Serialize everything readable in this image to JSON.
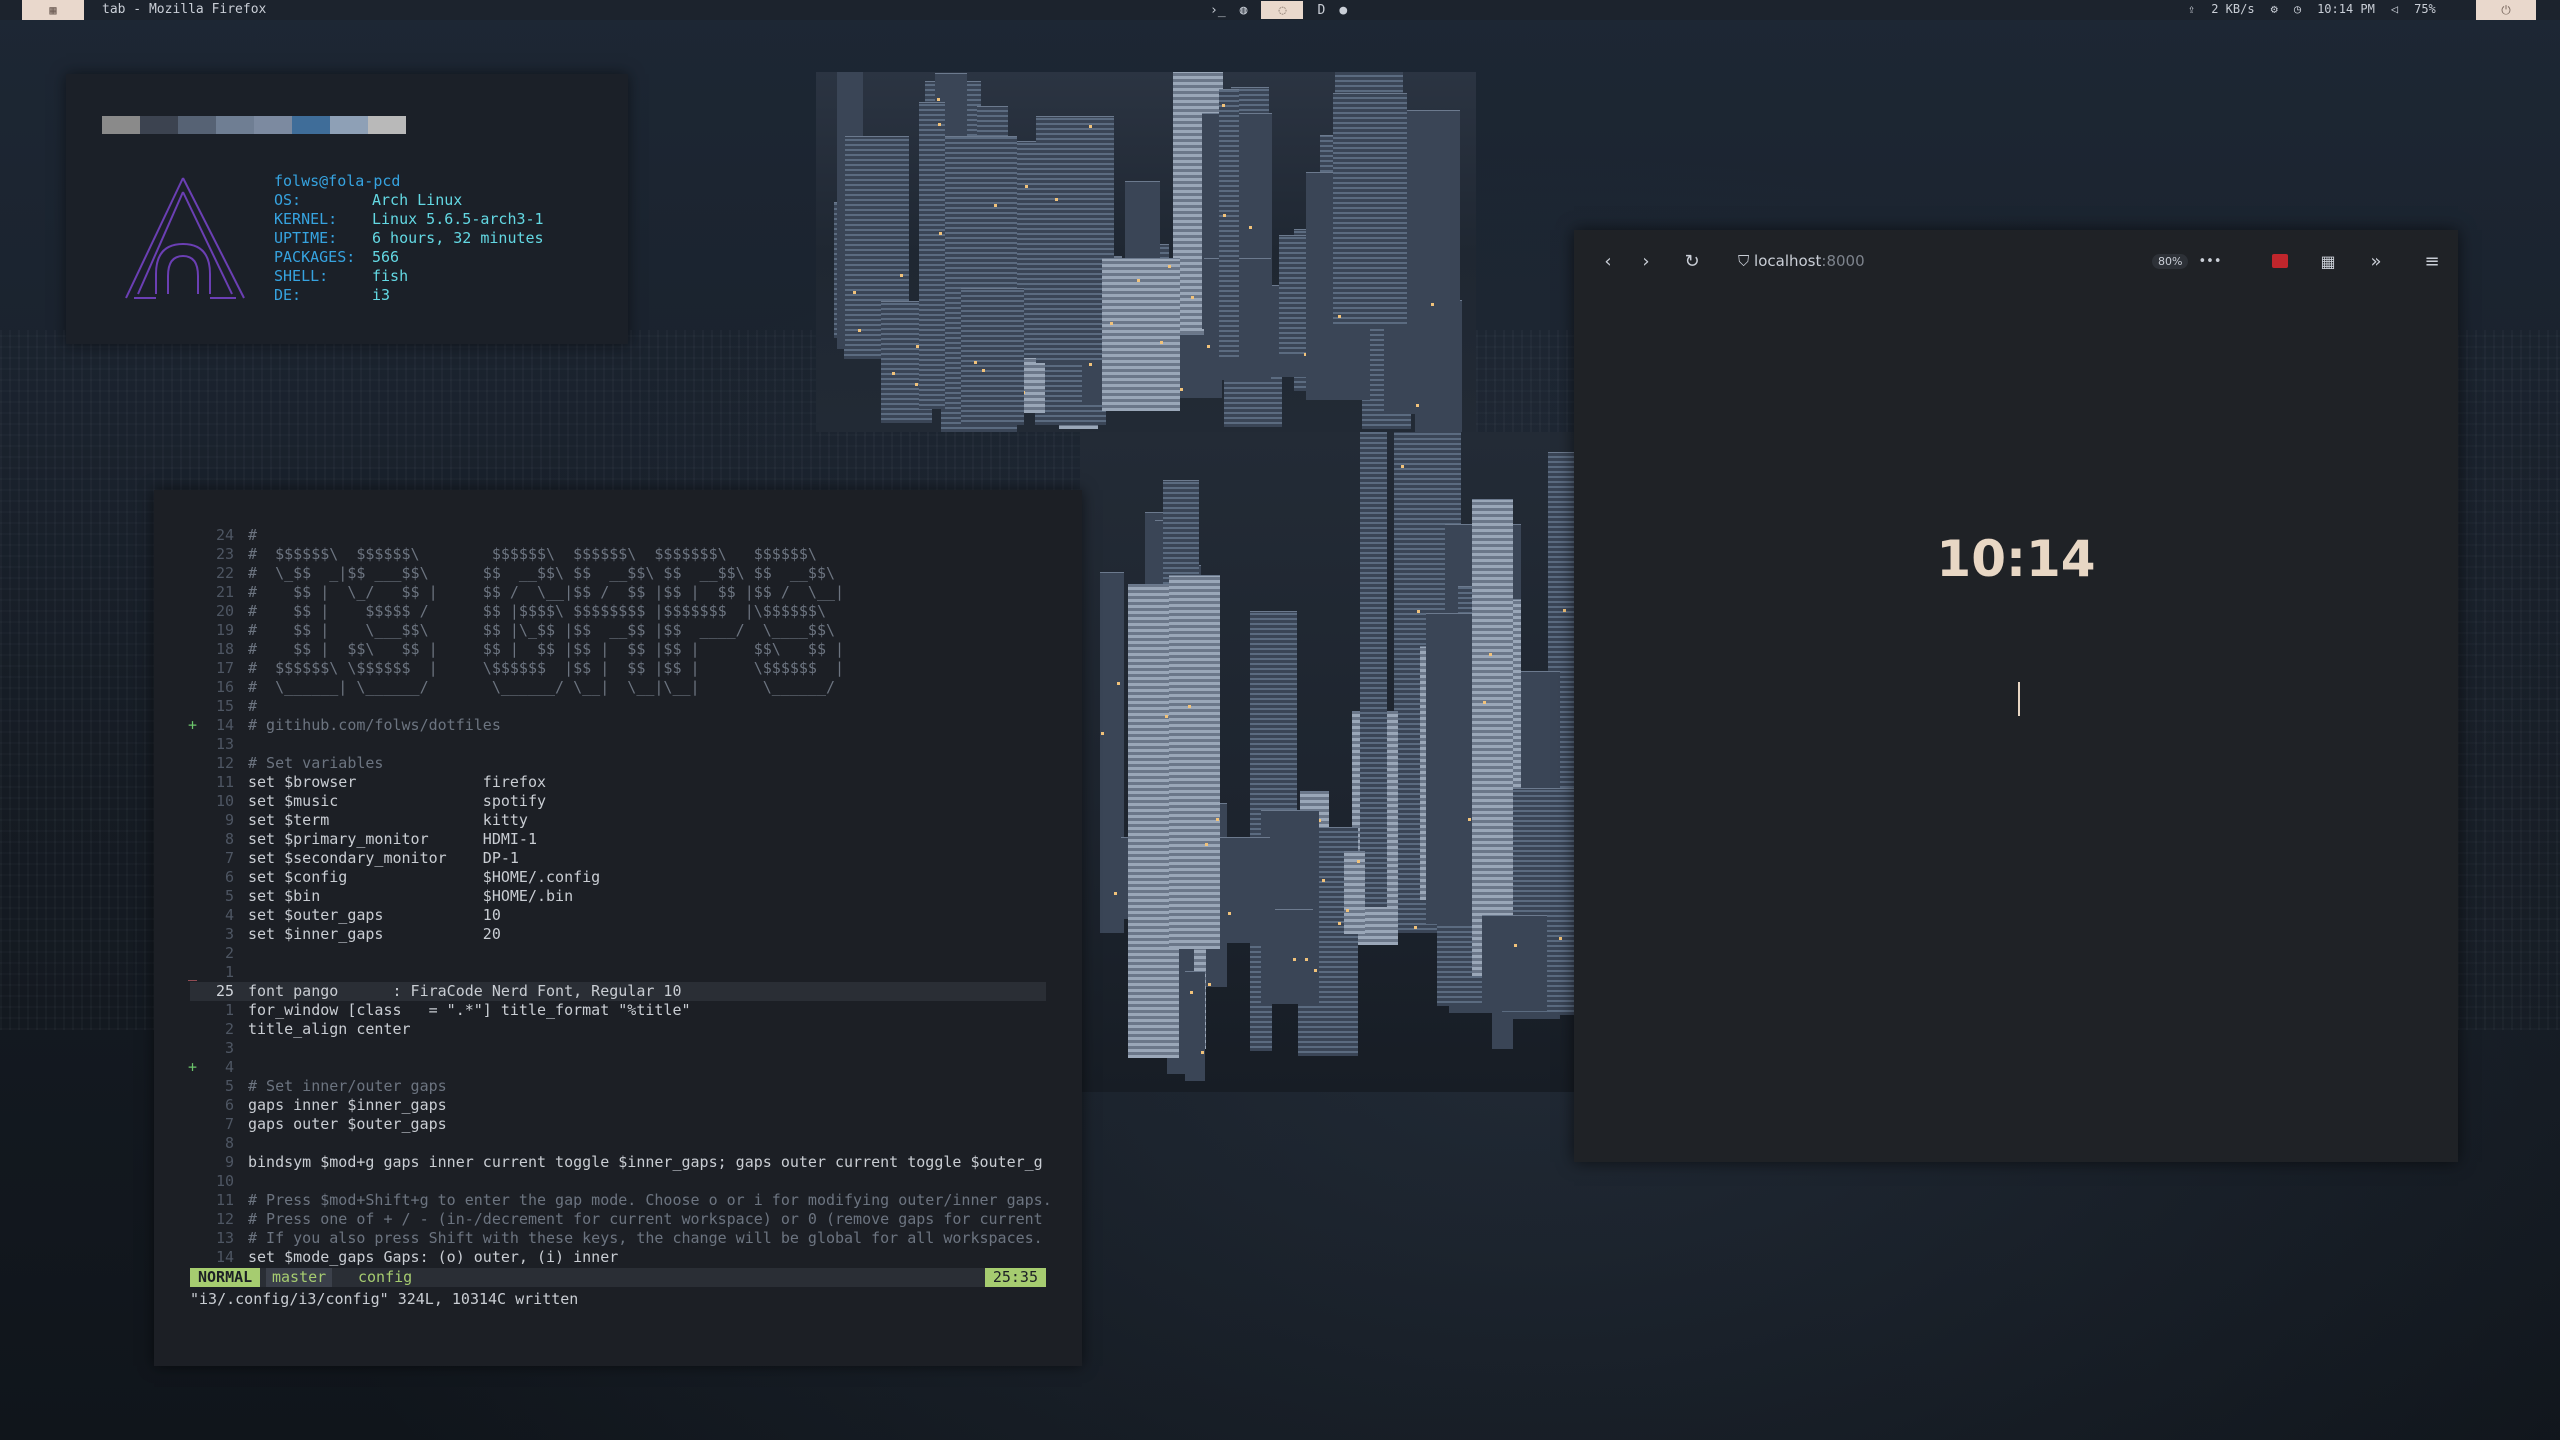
{
  "topbar": {
    "workspace_icon": "grid-icon",
    "window_title": "tab - Mozilla Firefox",
    "center": {
      "terminal_glyph": "›_",
      "globe_glyph": "◍",
      "active_glyph": "◌",
      "letter": "D",
      "spotify_glyph": "●"
    },
    "upload_glyph": "⇪",
    "net_speed": "2 KB/s",
    "clock": "10:14 PM",
    "volume": "75%",
    "power_glyph": "⏻"
  },
  "neofetch": {
    "user": "folws@fola-pcd",
    "rows": [
      {
        "key": "OS:",
        "value": "Arch Linux"
      },
      {
        "key": "KERNEL:",
        "value": "Linux 5.6.5-arch3-1"
      },
      {
        "key": "UPTIME:",
        "value": "6 hours, 32 minutes"
      },
      {
        "key": "PACKAGES:",
        "value": "566"
      },
      {
        "key": "SHELL:",
        "value": "fish"
      },
      {
        "key": "DE:",
        "value": "i3"
      }
    ],
    "swatch_colors": [
      "#8a8a8a",
      "#3c4350",
      "#566274",
      "#6f7e93",
      "#7c8aa0",
      "#3f6d99",
      "#8ea0b6",
      "#b9b9b9"
    ],
    "logo_color": "#6b3fb4"
  },
  "vim": {
    "lines": [
      {
        "n": "24",
        "t": "#",
        "cls": "comment"
      },
      {
        "n": "23",
        "t": "#  $$$$$$\\  $$$$$$\\        $$$$$$\\  $$$$$$\\  $$$$$$$\\   $$$$$$\\",
        "cls": "comment"
      },
      {
        "n": "22",
        "t": "#  \\_$$  _|$$ ___$$\\      $$  __$$\\ $$  __$$\\ $$  __$$\\ $$  __$$\\",
        "cls": "comment"
      },
      {
        "n": "21",
        "t": "#    $$ |  \\_/   $$ |     $$ /  \\__|$$ /  $$ |$$ |  $$ |$$ /  \\__|",
        "cls": "comment"
      },
      {
        "n": "20",
        "t": "#    $$ |    $$$$$ /      $$ |$$$$\\ $$$$$$$$ |$$$$$$$  |\\$$$$$$\\",
        "cls": "comment"
      },
      {
        "n": "19",
        "t": "#    $$ |    \\___$$\\      $$ |\\_$$ |$$  __$$ |$$  ____/  \\____$$\\",
        "cls": "comment"
      },
      {
        "n": "18",
        "t": "#    $$ |  $$\\   $$ |     $$ |  $$ |$$ |  $$ |$$ |      $$\\   $$ |",
        "cls": "comment"
      },
      {
        "n": "17",
        "t": "#  $$$$$$\\ \\$$$$$$  |     \\$$$$$$  |$$ |  $$ |$$ |      \\$$$$$$  |",
        "cls": "comment"
      },
      {
        "n": "16",
        "t": "#  \\______| \\______/       \\______/ \\__|  \\__|\\__|       \\______/",
        "cls": "comment"
      },
      {
        "n": "15",
        "t": "#",
        "cls": "comment"
      },
      {
        "n": "14",
        "t": "# gitihub.com/folws/dotfiles",
        "cls": "comment",
        "sign": "+"
      },
      {
        "n": "13",
        "t": "",
        "cls": "txt"
      },
      {
        "n": "12",
        "t": "# Set variables",
        "cls": "comment"
      },
      {
        "n": "11",
        "t": "set $browser              firefox",
        "cls": "txt"
      },
      {
        "n": "10",
        "t": "set $music                spotify",
        "cls": "txt"
      },
      {
        "n": "9",
        "t": "set $term                 kitty",
        "cls": "txt"
      },
      {
        "n": "8",
        "t": "set $primary_monitor      HDMI-1",
        "cls": "txt"
      },
      {
        "n": "7",
        "t": "set $secondary_monitor    DP-1",
        "cls": "txt"
      },
      {
        "n": "6",
        "t": "set $config               $HOME/.config",
        "cls": "txt"
      },
      {
        "n": "5",
        "t": "set $bin                  $HOME/.bin",
        "cls": "txt"
      },
      {
        "n": "4",
        "t": "set $outer_gaps           10",
        "cls": "txt"
      },
      {
        "n": "3",
        "t": "set $inner_gaps           20",
        "cls": "txt"
      },
      {
        "n": "2",
        "t": "",
        "cls": "txt"
      },
      {
        "n": "1",
        "t": "",
        "cls": "txt",
        "sign": "_"
      },
      {
        "n": "25",
        "t": "font pango      : FiraCode Nerd Font, Regular 10",
        "cls": "txt",
        "current": true
      },
      {
        "n": "1",
        "t": "for_window [class   = \".*\"] title_format \"%title\"",
        "cls": "txt"
      },
      {
        "n": "2",
        "t": "title_align center",
        "cls": "txt"
      },
      {
        "n": "3",
        "t": "",
        "cls": "txt"
      },
      {
        "n": "4",
        "t": "",
        "cls": "txt",
        "sign": "+"
      },
      {
        "n": "5",
        "t": "# Set inner/outer gaps",
        "cls": "comment"
      },
      {
        "n": "6",
        "t": "gaps inner $inner_gaps",
        "cls": "txt"
      },
      {
        "n": "7",
        "t": "gaps outer $outer_gaps",
        "cls": "txt"
      },
      {
        "n": "8",
        "t": "",
        "cls": "txt"
      },
      {
        "n": "9",
        "t": "bindsym $mod+g gaps inner current toggle $inner_gaps; gaps outer current toggle $outer_g",
        "cls": "txt"
      },
      {
        "n": "10",
        "t": "",
        "cls": "txt"
      },
      {
        "n": "11",
        "t": "# Press $mod+Shift+g to enter the gap mode. Choose o or i for modifying outer/inner gaps.",
        "cls": "comment"
      },
      {
        "n": "12",
        "t": "# Press one of + / - (in-/decrement for current workspace) or 0 (remove gaps for current",
        "cls": "comment"
      },
      {
        "n": "13",
        "t": "# If you also press Shift with these keys, the change will be global for all workspaces.",
        "cls": "comment"
      },
      {
        "n": "14",
        "t": "set $mode_gaps Gaps: (o) outer, (i) inner",
        "cls": "txt"
      }
    ],
    "status": {
      "mode": "NORMAL",
      "branch": "master",
      "file": "config",
      "position": "25:35"
    },
    "command_line": "\"i3/.config/i3/config\" 324L, 10314C written"
  },
  "firefox": {
    "url_host": "localhost",
    "url_port": ":8000",
    "zoom": "80%",
    "page_clock": "10:14",
    "icons": {
      "back": "‹",
      "forward": "›",
      "reload": "↻",
      "shield": "⛉",
      "more": "•••",
      "grid": "▦",
      "overflow": "»",
      "menu": "≡"
    }
  }
}
